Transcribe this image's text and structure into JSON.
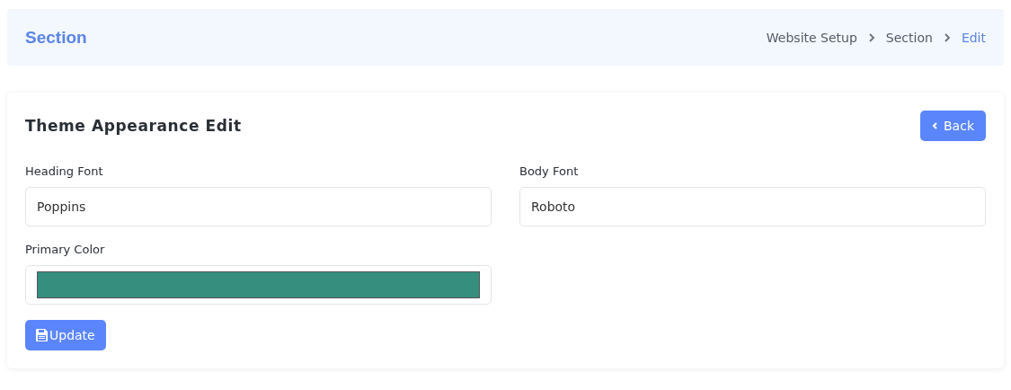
{
  "header": {
    "title": "Section",
    "breadcrumb": [
      {
        "label": "Website Setup",
        "selected": false
      },
      {
        "label": "Section",
        "selected": false
      },
      {
        "label": "Edit",
        "selected": true
      }
    ]
  },
  "card": {
    "title": "Theme Appearance Edit",
    "back_button": "Back",
    "fields": [
      {
        "label": "Heading Font",
        "kind": "text",
        "value": "Poppins"
      },
      {
        "label": "Body Font",
        "kind": "text",
        "value": "Roboto"
      },
      {
        "label": "Primary Color",
        "kind": "color",
        "color": "#358e7e"
      }
    ],
    "submit_button": "Update"
  }
}
